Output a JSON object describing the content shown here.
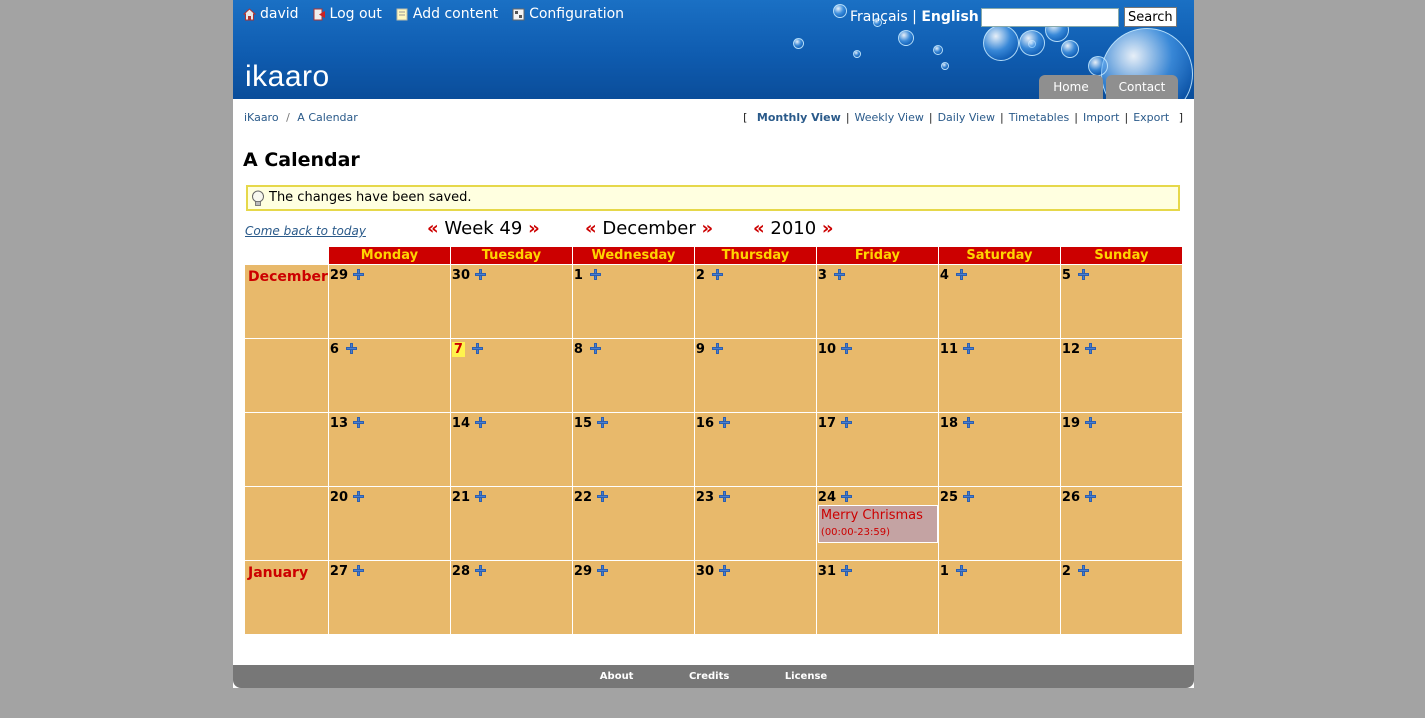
{
  "header": {
    "user_links": [
      {
        "label": "david",
        "icon": "home-icon"
      },
      {
        "label": "Log out",
        "icon": "logout-icon"
      },
      {
        "label": "Add content",
        "icon": "add-content-icon"
      },
      {
        "label": "Configuration",
        "icon": "configuration-icon"
      }
    ],
    "languages": [
      {
        "label": "Français",
        "active": false
      },
      {
        "label": "English",
        "active": true
      }
    ],
    "language_separator": "|",
    "search": {
      "value": "",
      "button": "Search"
    },
    "logo": "ikaaro",
    "tabs": [
      {
        "label": "Home"
      },
      {
        "label": "Contact"
      }
    ]
  },
  "breadcrumb": {
    "items": [
      "iKaaro",
      "A Calendar"
    ],
    "separator": "/"
  },
  "views": {
    "open_bracket": "[",
    "close_bracket": "]",
    "items": [
      "Monthly View",
      "Weekly View",
      "Daily View",
      "Timetables",
      "Import",
      "Export"
    ],
    "current": "Monthly View"
  },
  "page_title": "A Calendar",
  "message": "The changes have been saved.",
  "nav": {
    "today_link": "Come back to today",
    "prev": "«",
    "next": "»",
    "week": "Week 49",
    "month": "December",
    "year": "2010"
  },
  "calendar": {
    "days": [
      "Monday",
      "Tuesday",
      "Wednesday",
      "Thursday",
      "Friday",
      "Saturday",
      "Sunday"
    ],
    "weeks": [
      {
        "month": "December",
        "days": [
          "29",
          "30",
          "1",
          "2",
          "3",
          "4",
          "5"
        ]
      },
      {
        "month": "",
        "days": [
          "6",
          "7",
          "8",
          "9",
          "10",
          "11",
          "12"
        ]
      },
      {
        "month": "",
        "days": [
          "13",
          "14",
          "15",
          "16",
          "17",
          "18",
          "19"
        ]
      },
      {
        "month": "",
        "days": [
          "20",
          "21",
          "22",
          "23",
          "24",
          "25",
          "26"
        ]
      },
      {
        "month": "January",
        "days": [
          "27",
          "28",
          "29",
          "30",
          "31",
          "1",
          "2"
        ]
      }
    ],
    "today": "7",
    "event": {
      "title": "Merry Chrismas",
      "time": "(00:00-23:59)",
      "day": "24"
    }
  },
  "footer": {
    "links": [
      "About",
      "Credits",
      "License"
    ]
  },
  "colors": {
    "header_blue": "#0f5cb0",
    "day_header_bg": "#cc0000",
    "day_header_text": "#ffd400",
    "cell_bg": "#e8b96b",
    "event_bg": "#c4a3a3",
    "accent_red": "#cc0000",
    "link": "#2a5a8a"
  }
}
